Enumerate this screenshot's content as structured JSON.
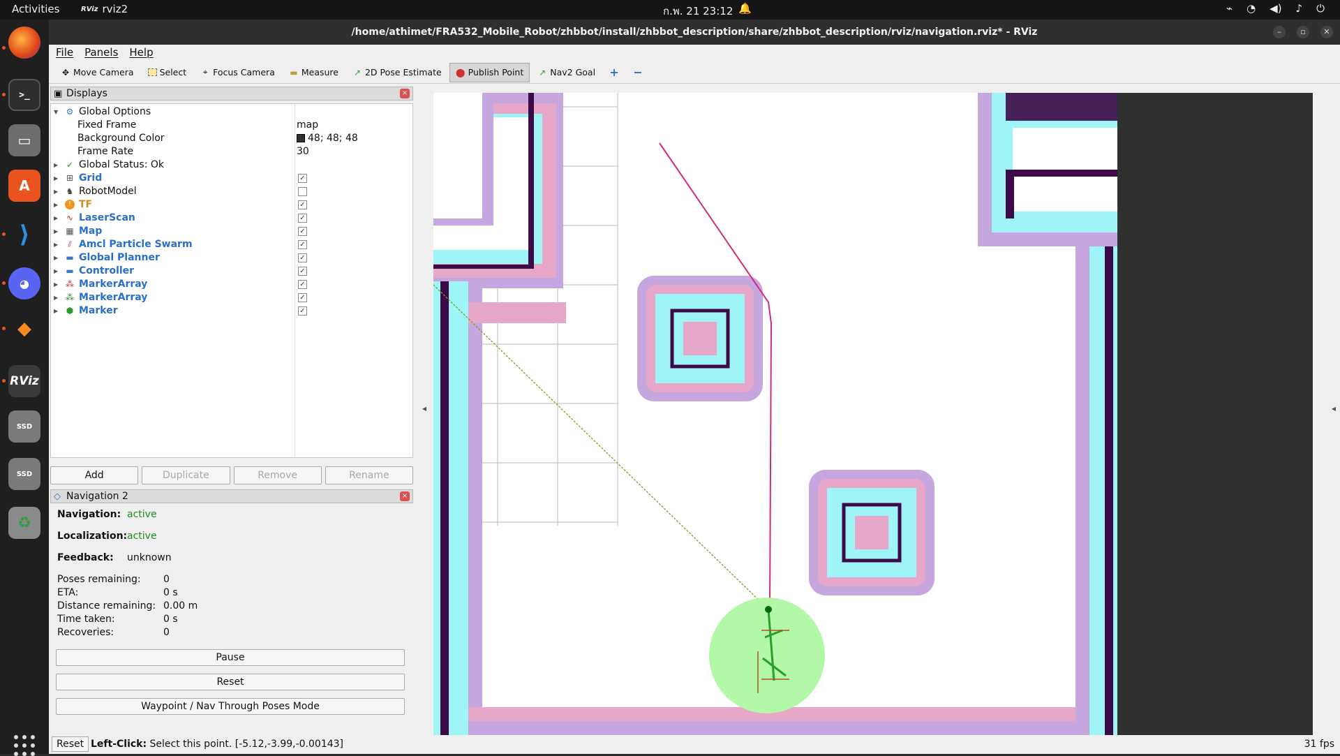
{
  "topbar": {
    "activities": "Activities",
    "app_name": "rviz2",
    "clock": "ก.พ. 21  23:12"
  },
  "window": {
    "title": "/home/athimet/FRA532_Mobile_Robot/zhbbot/install/zhbbot_description/share/zhbbot_description/rviz/navigation.rviz* - RViz"
  },
  "menu": {
    "file": "File",
    "panels": "Panels",
    "help": "Help"
  },
  "toolbar": {
    "move_camera": "Move Camera",
    "select": "Select",
    "focus_camera": "Focus Camera",
    "measure": "Measure",
    "pose_estimate": "2D Pose Estimate",
    "publish_point": "Publish Point",
    "nav2_goal": "Nav2 Goal"
  },
  "displays": {
    "title": "Displays",
    "global_options": "Global Options",
    "fixed_frame_label": "Fixed Frame",
    "fixed_frame_value": "map",
    "bg_color_label": "Background Color",
    "bg_color_value": "48; 48; 48",
    "frame_rate_label": "Frame Rate",
    "frame_rate_value": "30",
    "global_status": "Global Status: Ok",
    "items": [
      {
        "label": "Grid",
        "checked": true
      },
      {
        "label": "RobotModel",
        "checked": false
      },
      {
        "label": "TF",
        "checked": true
      },
      {
        "label": "LaserScan",
        "checked": true
      },
      {
        "label": "Map",
        "checked": true
      },
      {
        "label": "Amcl Particle Swarm",
        "checked": true
      },
      {
        "label": "Global Planner",
        "checked": true
      },
      {
        "label": "Controller",
        "checked": true
      },
      {
        "label": "MarkerArray",
        "checked": true
      },
      {
        "label": "MarkerArray",
        "checked": true
      },
      {
        "label": "Marker",
        "checked": true
      }
    ],
    "buttons": {
      "add": "Add",
      "duplicate": "Duplicate",
      "remove": "Remove",
      "rename": "Rename"
    }
  },
  "navigation": {
    "title": "Navigation 2",
    "nav_label": "Navigation:",
    "nav_value": "active",
    "loc_label": "Localization:",
    "loc_value": "active",
    "fb_label": "Feedback:",
    "fb_value": "unknown",
    "poses_label": "Poses remaining:",
    "poses_value": "0",
    "eta_label": "ETA:",
    "eta_value": "0 s",
    "dist_label": "Distance remaining:",
    "dist_value": "0.00 m",
    "time_label": "Time taken:",
    "time_value": "0 s",
    "rec_label": "Recoveries:",
    "rec_value": "0",
    "pause": "Pause",
    "reset": "Reset",
    "waypoint": "Waypoint / Nav Through Poses Mode"
  },
  "status": {
    "reset": "Reset",
    "hint_bold": "Left-Click:",
    "hint": " Select this point. [-5.12,-3.99,-0.00143]",
    "fps": "31 fps"
  },
  "colors": {
    "background": "#303030",
    "free_space": "#ffffff",
    "wall": "#3c0a48",
    "cost_inner": "#9ff4f6",
    "cost_outer": "#c6a6de",
    "cost_mid": "#e7a7c8",
    "robot_footprint": "#b3f7a9",
    "path": "#d42a7c"
  }
}
